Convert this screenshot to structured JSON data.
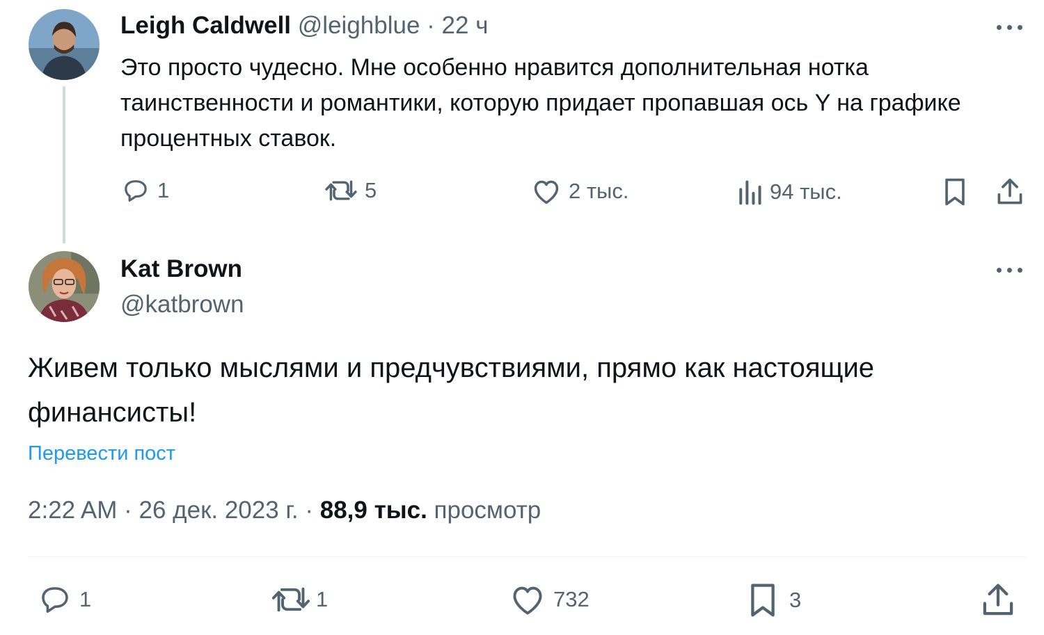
{
  "tweet1": {
    "name": "Leigh Caldwell",
    "handle": "@leighblue",
    "separator": " · ",
    "time": "22 ч",
    "text": "Это просто чудесно. Мне особенно нравится дополнительная нотка таинственности и романтики, которую придает пропавшая ось Y на графике процентных ставок.",
    "actions": {
      "replies": "1",
      "reposts": "5",
      "likes": "2 тыс.",
      "views": "94 тыс."
    },
    "icons": [
      "more-icon",
      "reply-icon",
      "repost-icon",
      "like-icon",
      "views-icon",
      "bookmark-icon",
      "share-icon"
    ]
  },
  "tweet2": {
    "name": "Kat Brown",
    "handle": "@katbrown",
    "text": "Живем только мыслями и предчувствиями, прямо как настоящие финансисты!",
    "translate": "Перевести пост",
    "meta": {
      "time": "2:22 AM",
      "separator": " · ",
      "date": "26 дек. 2023 г.",
      "separator2": " · ",
      "views_count": "88,9 тыс.",
      "views_label": " просмотр"
    },
    "actions": {
      "replies": "1",
      "reposts": "1",
      "likes": "732",
      "bookmarks": "3"
    }
  },
  "colors": {
    "text": "#0f1419",
    "muted": "#536471",
    "link": "#1d9bf0",
    "thread_line": "#cfd9de"
  }
}
